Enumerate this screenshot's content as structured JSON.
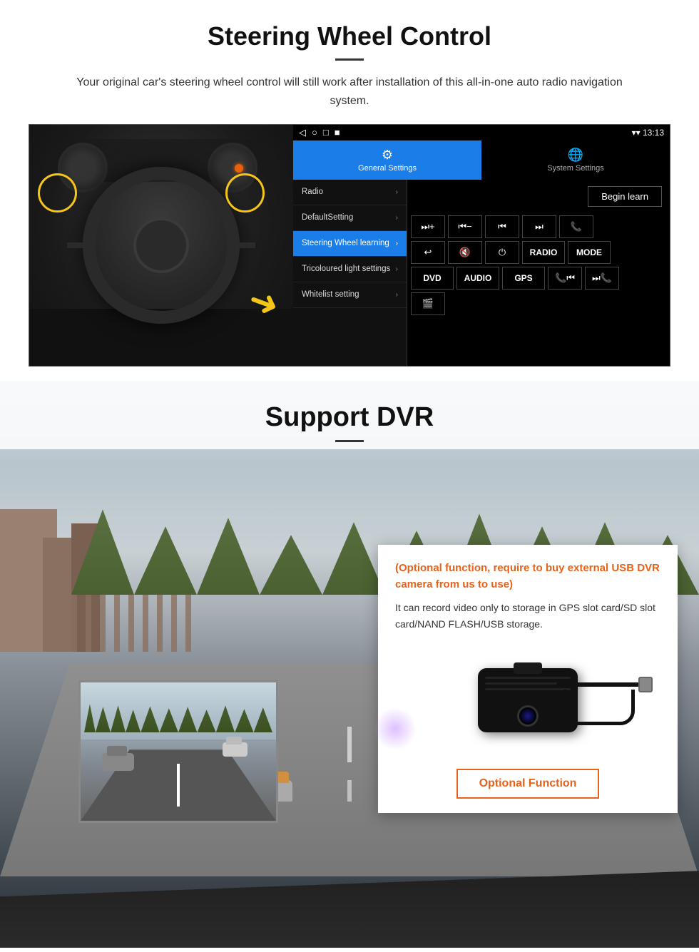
{
  "section1": {
    "title": "Steering Wheel Control",
    "subtitle": "Your original car's steering wheel control will still work after installation of this all-in-one auto radio navigation system.",
    "android": {
      "statusbar": {
        "icons": [
          "◁",
          "○",
          "□",
          "■"
        ],
        "time": "13:13",
        "signal": "▼"
      },
      "tabs": {
        "general": {
          "label": "General Settings",
          "icon": "⚙"
        },
        "system": {
          "label": "System Settings",
          "icon": "🌐"
        }
      },
      "menu": [
        {
          "label": "Radio",
          "active": false
        },
        {
          "label": "DefaultSetting",
          "active": false
        },
        {
          "label": "Steering Wheel learning",
          "active": true
        },
        {
          "label": "Tricoloured light settings",
          "active": false
        },
        {
          "label": "Whitelist setting",
          "active": false
        }
      ],
      "begin_learn": "Begin learn",
      "controls": {
        "row1": [
          "⏭+",
          "⏮−",
          "⏮⏮",
          "⏭⏭",
          "📞"
        ],
        "row2": [
          "↩",
          "🔇",
          "⏻",
          "RADIO",
          "MODE"
        ],
        "row3": [
          "DVD",
          "AUDIO",
          "GPS",
          "📞⏮",
          "⏭📞"
        ],
        "row4": [
          "📼"
        ]
      }
    }
  },
  "section2": {
    "title": "Support DVR",
    "optional_text": "(Optional function, require to buy external USB DVR camera from us to use)",
    "desc_text": "It can record video only to storage in GPS slot card/SD slot card/NAND FLASH/USB storage.",
    "optional_function_btn": "Optional Function"
  }
}
